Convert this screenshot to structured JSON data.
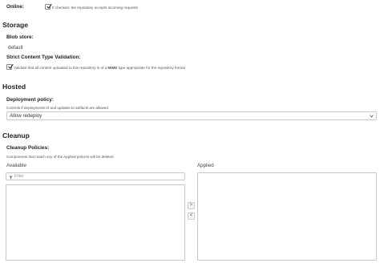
{
  "online": {
    "label": "Online:",
    "checked": true,
    "description": "If checked, the repository accepts incoming requests"
  },
  "storage": {
    "heading": "Storage",
    "blob_store_label": "Blob store:",
    "blob_store_value": "default",
    "strict_label": "Strict Content Type Validation:",
    "strict_checked": true,
    "strict_description_pre": "Validate that all content uploaded to this repository is of a ",
    "strict_description_bold": "MIME",
    "strict_description_post": " type appropriate for the repository format"
  },
  "hosted": {
    "heading": "Hosted",
    "policy_label": "Deployment policy:",
    "policy_description": "Controls if deployments of and updates to artifacts are allowed",
    "policy_selected": "Allow redeploy"
  },
  "cleanup": {
    "heading": "Cleanup",
    "policies_label": "Cleanup Policies:",
    "policies_description": "Components that match any of the Applied policies will be deleted",
    "available_label": "Available",
    "applied_label": "Applied",
    "filter_placeholder": "Filter",
    "move_right": ">",
    "move_left": "<"
  },
  "icons": {
    "checkbox_tick": "check-icon",
    "select_caret": "chevron-down-icon",
    "filter": "filter-icon"
  },
  "colors": {
    "text": "#333333",
    "border": "#c8c8c8"
  }
}
